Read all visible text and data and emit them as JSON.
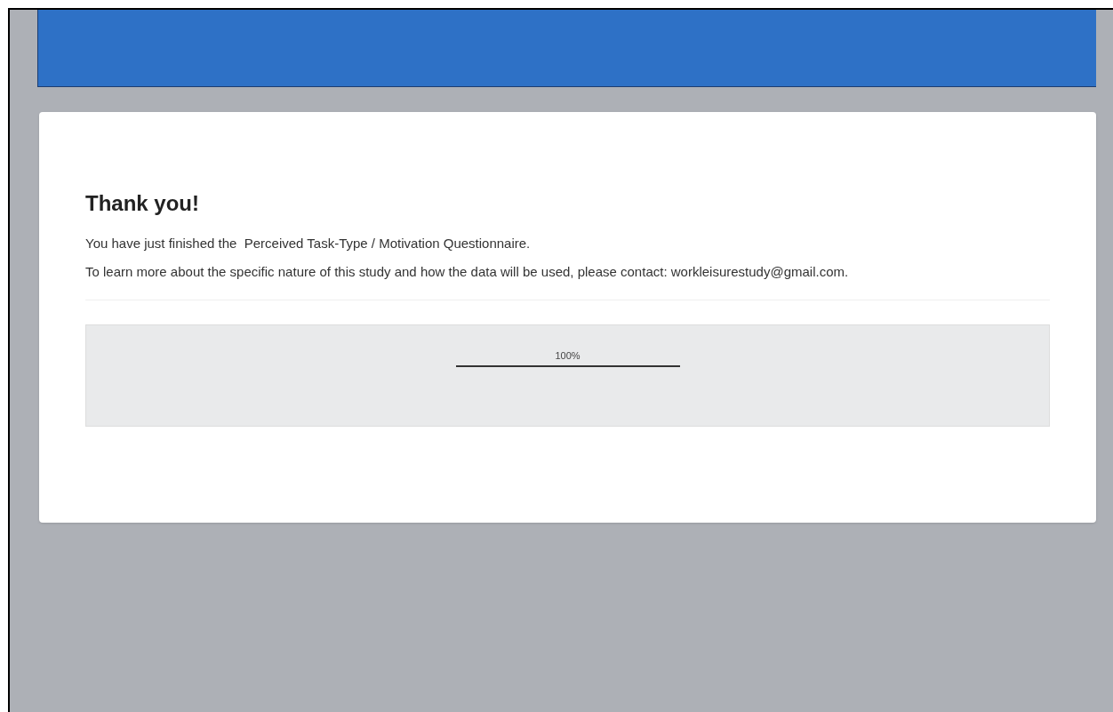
{
  "heading": "Thank you!",
  "paragraphs": [
    "You have just finished the  Perceived Task-Type / Motivation Questionnaire.",
    "To learn more about the specific nature of this study and how the data will be used, please contact: workleisurestudy@gmail.com."
  ],
  "progress": {
    "label": "100%",
    "level": 1
  }
}
